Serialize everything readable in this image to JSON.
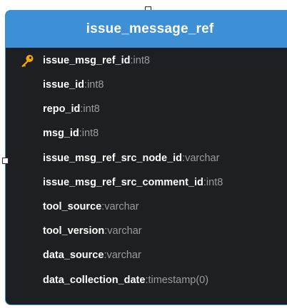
{
  "table": {
    "title": "issue_message_ref",
    "columns": [
      {
        "name": "issue_msg_ref_id",
        "sep": ":",
        "type": "int8",
        "primary_key": true
      },
      {
        "name": "issue_id",
        "sep": ":",
        "type": "int8",
        "primary_key": false
      },
      {
        "name": "repo_id",
        "sep": ":",
        "type": "int8",
        "primary_key": false
      },
      {
        "name": "msg_id",
        "sep": ":",
        "type": "int8",
        "primary_key": false
      },
      {
        "name": "issue_msg_ref_src_node_id",
        "sep": ":",
        "type": "varchar",
        "primary_key": false
      },
      {
        "name": "issue_msg_ref_src_comment_id",
        "sep": ":",
        "type": "int8",
        "primary_key": false
      },
      {
        "name": "tool_source",
        "sep": ":",
        "type": "varchar",
        "primary_key": false
      },
      {
        "name": "tool_version",
        "sep": ":",
        "type": "varchar",
        "primary_key": false
      },
      {
        "name": "data_source",
        "sep": ":",
        "type": "varchar",
        "primary_key": false
      },
      {
        "name": "data_collection_date",
        "sep": ":",
        "type": "timestamp(0)",
        "primary_key": false
      }
    ]
  },
  "icons": {
    "primary_key": "key-icon",
    "connection_handle": "connector-handle"
  },
  "colors": {
    "header_background": "#3d8fd6",
    "card_border": "#3f8bd0",
    "card_background": "#1e1f22",
    "column_name": "#ffffff",
    "column_type": "#9a9ca0",
    "key_icon": "#f2a90b"
  }
}
